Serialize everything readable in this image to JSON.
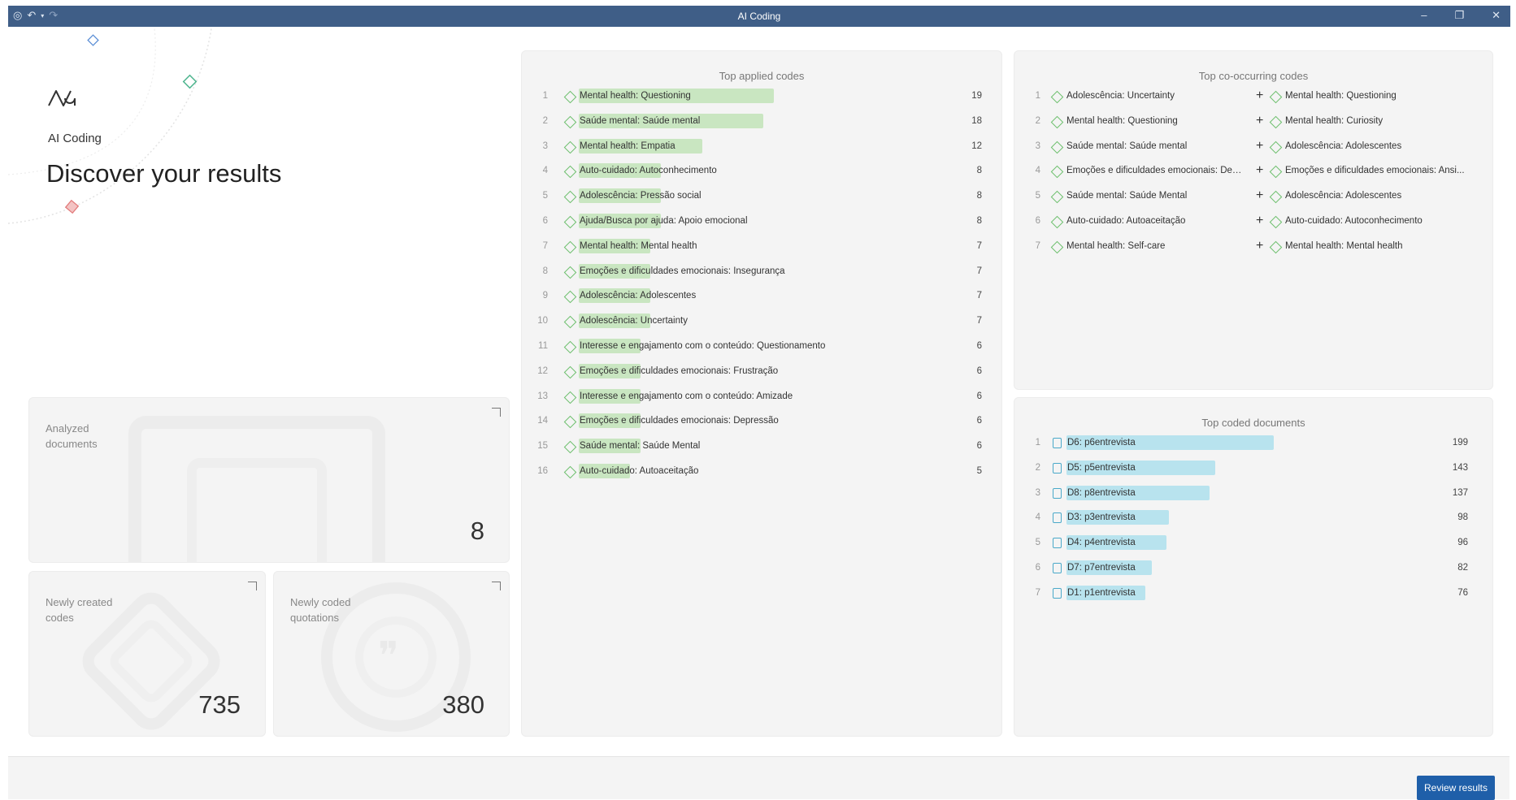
{
  "window": {
    "title": "AI Coding",
    "icons": [
      "app-menu-icon",
      "undo-icon",
      "dropdown-caret-icon",
      "redo-icon",
      "minimize-icon",
      "restore-icon",
      "close-icon"
    ]
  },
  "hero": {
    "app_name": "AI Coding",
    "title": "Discover your results"
  },
  "stats": {
    "analyzed_documents": {
      "label": "Analyzed documents",
      "value": "8"
    },
    "newly_created_codes": {
      "label": "Newly created codes",
      "value": "735"
    },
    "newly_coded_quotations": {
      "label": "Newly coded quotations",
      "value": "380"
    }
  },
  "top_applied_codes": {
    "title": "Top applied codes",
    "max": 19,
    "items": [
      {
        "rank": "1",
        "label": "Mental health: Questioning",
        "count": 19
      },
      {
        "rank": "2",
        "label": "Saúde mental: Saúde mental",
        "count": 18
      },
      {
        "rank": "3",
        "label": "Mental health: Empatia",
        "count": 12
      },
      {
        "rank": "4",
        "label": "Auto-cuidado: Autoconhecimento",
        "count": 8
      },
      {
        "rank": "5",
        "label": "Adolescência: Pressão social",
        "count": 8
      },
      {
        "rank": "6",
        "label": "Ajuda/Busca por ajuda: Apoio emocional",
        "count": 8
      },
      {
        "rank": "7",
        "label": "Mental health: Mental health",
        "count": 7
      },
      {
        "rank": "8",
        "label": "Emoções e dificuldades emocionais: Insegurança",
        "count": 7
      },
      {
        "rank": "9",
        "label": "Adolescência: Adolescentes",
        "count": 7
      },
      {
        "rank": "10",
        "label": "Adolescência: Uncertainty",
        "count": 7
      },
      {
        "rank": "11",
        "label": "Interesse e engajamento com o conteúdo: Questionamento",
        "count": 6
      },
      {
        "rank": "12",
        "label": "Emoções e dificuldades emocionais: Frustração",
        "count": 6
      },
      {
        "rank": "13",
        "label": "Interesse e engajamento com o conteúdo: Amizade",
        "count": 6
      },
      {
        "rank": "14",
        "label": "Emoções e dificuldades emocionais: Depressão",
        "count": 6
      },
      {
        "rank": "15",
        "label": "Saúde mental: Saúde Mental",
        "count": 6
      },
      {
        "rank": "16",
        "label": "Auto-cuidado: Autoaceitação",
        "count": 5
      }
    ]
  },
  "top_cooccurring_codes": {
    "title": "Top co-occurring codes",
    "items": [
      {
        "rank": "1",
        "left": "Adolescência: Uncertainty",
        "right": "Mental health: Questioning"
      },
      {
        "rank": "2",
        "left": "Mental health: Questioning",
        "right": "Mental health: Curiosity"
      },
      {
        "rank": "3",
        "left": "Saúde mental: Saúde mental",
        "right": "Adolescência: Adolescentes"
      },
      {
        "rank": "4",
        "left": "Emoções e dificuldades emocionais: Depr...",
        "right": "Emoções e dificuldades emocionais: Ansi..."
      },
      {
        "rank": "5",
        "left": "Saúde mental: Saúde Mental",
        "right": "Adolescência: Adolescentes"
      },
      {
        "rank": "6",
        "left": "Auto-cuidado: Autoaceitação",
        "right": "Auto-cuidado: Autoconhecimento"
      },
      {
        "rank": "7",
        "left": "Mental health: Self-care",
        "right": "Mental health: Mental health"
      }
    ]
  },
  "top_coded_documents": {
    "title": "Top coded documents",
    "max": 199,
    "items": [
      {
        "rank": "1",
        "label": "D6: p6entrevista",
        "count": 199
      },
      {
        "rank": "2",
        "label": "D5: p5entrevista",
        "count": 143
      },
      {
        "rank": "3",
        "label": "D8: p8entrevista",
        "count": 137
      },
      {
        "rank": "4",
        "label": "D3: p3entrevista",
        "count": 98
      },
      {
        "rank": "5",
        "label": "D4: p4entrevista",
        "count": 96
      },
      {
        "rank": "6",
        "label": "D7: p7entrevista",
        "count": 82
      },
      {
        "rank": "7",
        "label": "D1: p1entrevista",
        "count": 76
      }
    ]
  },
  "colors": {
    "titlebar": "#3f5e87",
    "code_bar": "#c9e6c1",
    "doc_bar": "#b8e3ee",
    "primary_button": "#1f5fa9"
  },
  "footer": {
    "review_button": "Review results"
  }
}
